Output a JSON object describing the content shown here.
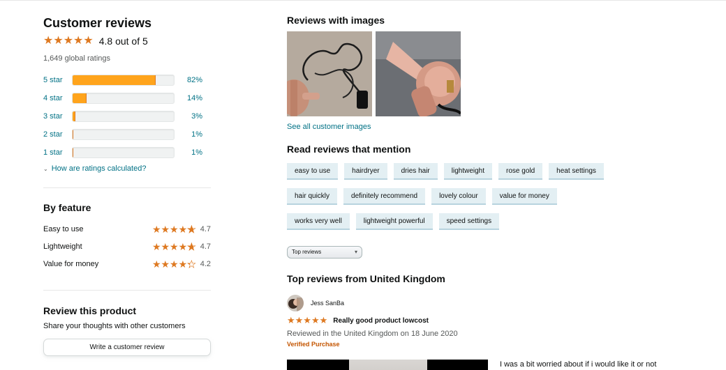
{
  "left": {
    "title": "Customer reviews",
    "average": "4.8 out of 5",
    "global_ratings": "1,649 global ratings",
    "histogram": [
      {
        "label": "5 star",
        "percent": 82,
        "percent_text": "82%"
      },
      {
        "label": "4 star",
        "percent": 14,
        "percent_text": "14%"
      },
      {
        "label": "3 star",
        "percent": 3,
        "percent_text": "3%"
      },
      {
        "label": "2 star",
        "percent": 1,
        "percent_text": "1%"
      },
      {
        "label": "1 star",
        "percent": 1,
        "percent_text": "1%"
      }
    ],
    "how_link": "How are ratings calculated?",
    "by_feature": {
      "title": "By feature",
      "items": [
        {
          "name": "Easy to use",
          "rating": "4.7"
        },
        {
          "name": "Lightweight",
          "rating": "4.7"
        },
        {
          "name": "Value for money",
          "rating": "4.2"
        }
      ]
    },
    "review_product": {
      "title": "Review this product",
      "subtitle": "Share your thoughts with other customers",
      "button": "Write a customer review"
    }
  },
  "right": {
    "images_title": "Reviews with images",
    "see_all": "See all customer images",
    "mention_title": "Read reviews that mention",
    "chips": [
      "easy to use",
      "hairdryer",
      "dries hair",
      "lightweight",
      "rose gold",
      "heat settings",
      "hair quickly",
      "definitely recommend",
      "lovely colour",
      "value for money",
      "works very well",
      "lightweight powerful",
      "speed settings"
    ],
    "sort_label": "Top reviews",
    "top_reviews_title": "Top reviews from United Kingdom",
    "review": {
      "author": "Jess SanBa",
      "title": "Really good product lowcost",
      "meta": "Reviewed in the United Kingdom on 18 June 2020",
      "verified": "Verified Purchase",
      "text": "I was a bit worried about if i would like it or not"
    }
  },
  "colors": {
    "star": "#de7921",
    "bar_fill": "#ffa41c",
    "link": "#007185",
    "verified": "#c45500"
  },
  "icons": {
    "star": "star-icon",
    "chevron": "chevron-down-icon"
  }
}
